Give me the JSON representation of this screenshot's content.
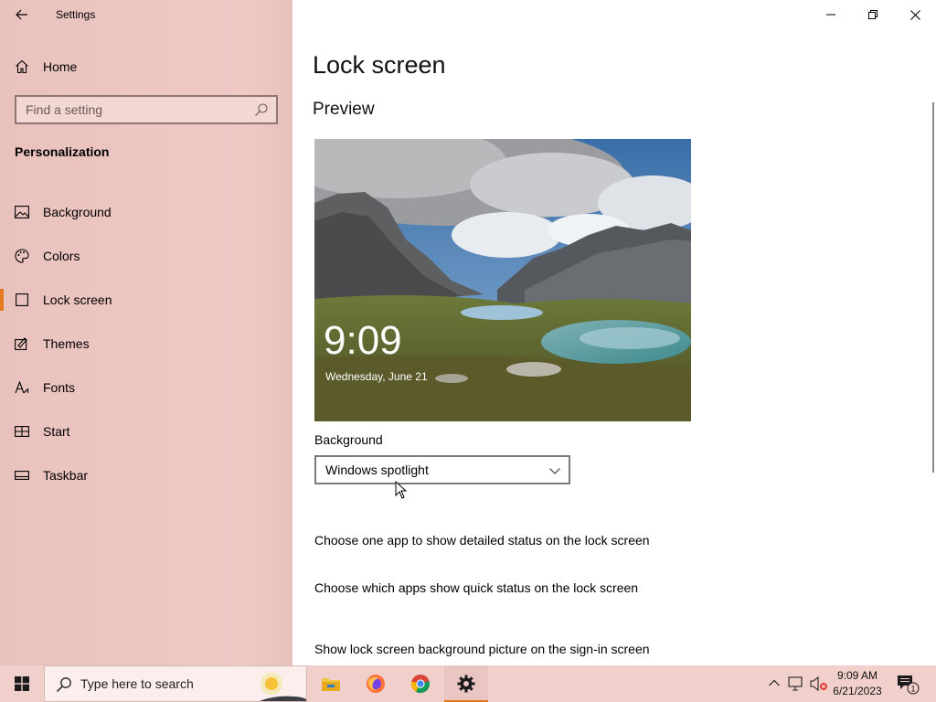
{
  "window": {
    "title": "Settings"
  },
  "sidebar": {
    "home_label": "Home",
    "search_placeholder": "Find a setting",
    "section_title": "Personalization",
    "items": [
      {
        "label": "Background",
        "icon": "image-icon",
        "active": false
      },
      {
        "label": "Colors",
        "icon": "palette-icon",
        "active": false
      },
      {
        "label": "Lock screen",
        "icon": "lock-screen-icon",
        "active": true
      },
      {
        "label": "Themes",
        "icon": "themes-icon",
        "active": false
      },
      {
        "label": "Fonts",
        "icon": "fonts-icon",
        "active": false
      },
      {
        "label": "Start",
        "icon": "start-icon",
        "active": false
      },
      {
        "label": "Taskbar",
        "icon": "taskbar-icon",
        "active": false
      }
    ]
  },
  "main": {
    "page_title": "Lock screen",
    "preview_title": "Preview",
    "preview_time": "9:09",
    "preview_date": "Wednesday, June 21",
    "background_label": "Background",
    "background_value": "Windows spotlight",
    "links": [
      "Choose one app to show detailed status on the lock screen",
      "Choose which apps show quick status on the lock screen",
      "Show lock screen background picture on the sign-in screen"
    ]
  },
  "taskbar": {
    "search_placeholder": "Type here to search",
    "apps": [
      "file-explorer-icon",
      "firefox-icon",
      "chrome-icon",
      "settings-icon"
    ],
    "clock_time": "9:09 AM",
    "clock_date": "6/21/2023",
    "notification_count": "1"
  },
  "colors": {
    "accent": "#e5791f",
    "sidebar_bg": "#efc9c4",
    "taskbar_bg": "#f1d0cb"
  }
}
